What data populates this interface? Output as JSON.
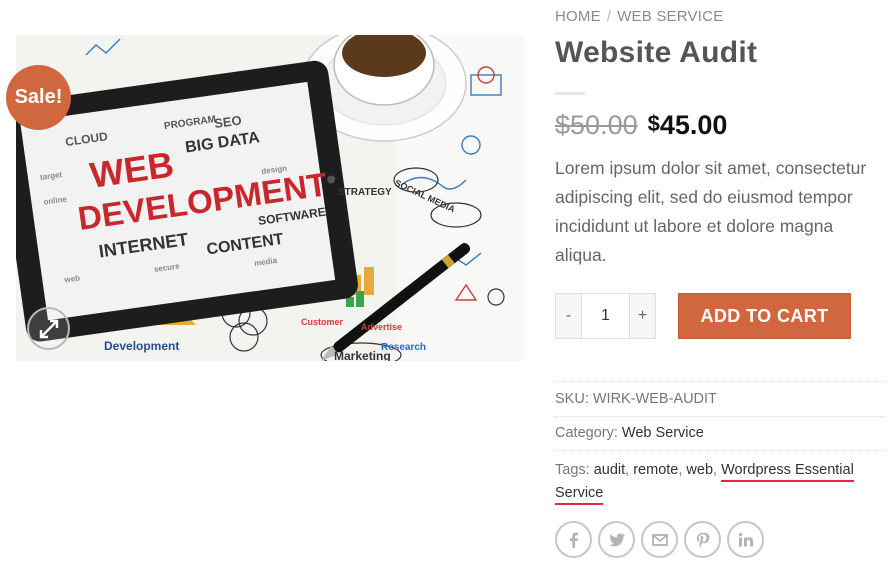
{
  "product": {
    "sale_badge": "Sale!",
    "image_alt": "Web development tablet illustration",
    "image_words": {
      "web": "WEB",
      "development": "DEVELOPMENT",
      "internet": "INTERNET",
      "software": "SOFTWARE",
      "content": "CONTENT",
      "big_data": "BIG DATA",
      "cloud": "CLOUD",
      "seo": "SEO",
      "program": "PROGRAM",
      "social_media": "SOCIAL MEDIA",
      "strategy": "STRATEGY",
      "development_label": "Development",
      "marketing": "Marketing",
      "research": "Research",
      "customer": "Customer",
      "advertise": "Advertise"
    }
  },
  "breadcrumb": {
    "home": "Home",
    "separator": "/",
    "current": "Web Service"
  },
  "title": "Website Audit",
  "price": {
    "currency": "$",
    "old": "50.00",
    "new": "45.00"
  },
  "description": "Lorem ipsum dolor sit amet, consectetur adipiscing elit, sed do eiusmod tempor incididunt ut labore et dolore magna aliqua.",
  "quantity": {
    "minus": "-",
    "value": "1",
    "plus": "+"
  },
  "add_to_cart": "ADD TO CART",
  "meta": {
    "sku_label": "SKU:",
    "sku_value": "WIRK-WEB-AUDIT",
    "category_label": "Category:",
    "category_value": "Web Service",
    "tags_label": "Tags:",
    "tags": [
      "audit",
      "remote",
      "web",
      "Wordpress Essential",
      "Service"
    ],
    "tag_separator": ","
  },
  "share": [
    "facebook-icon",
    "twitter-icon",
    "email-icon",
    "pinterest-icon",
    "linkedin-icon"
  ],
  "colors": {
    "accent": "#d0673f",
    "tag_underline": "#e0264a"
  }
}
